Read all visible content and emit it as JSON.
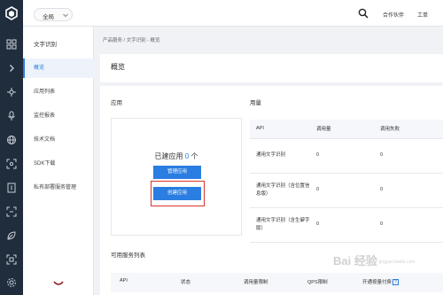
{
  "topbar": {
    "region": "全局",
    "links": [
      "合作伙伴",
      "工单"
    ]
  },
  "rail_icons": [
    "grid-icon",
    "chevron-right-icon",
    "cube-icon",
    "microphone-icon",
    "globe-icon",
    "scan-icon",
    "document-icon",
    "bracket-icon",
    "leaf-icon",
    "frame-icon",
    "gear-icon"
  ],
  "sidebar": {
    "title": "文字识别",
    "items": [
      {
        "label": "概览",
        "active": true
      },
      {
        "label": "应用列表"
      },
      {
        "label": "监控报表"
      },
      {
        "label": "技术文档"
      },
      {
        "label": "SDK下载"
      },
      {
        "label": "私有部署服务管理"
      }
    ]
  },
  "breadcrumb": "产品服务 / 文字识别 - 概览",
  "page_title": "概览",
  "apps": {
    "section_title": "应用",
    "created_prefix": "已建应用",
    "created_count": "0",
    "created_suffix": "个",
    "manage_button": "管理应用",
    "create_button": "创建应用"
  },
  "usage": {
    "section_title": "用量",
    "columns": [
      "API",
      "调用量",
      "调用失败"
    ],
    "rows": [
      {
        "api": "通用文字识别",
        "calls": "0",
        "failed": "0"
      },
      {
        "api": "通用文字识别（含位置信息版）",
        "calls": "0",
        "failed": "0"
      },
      {
        "api": "通用文字识别（含生僻字版）",
        "calls": "0",
        "failed": "0"
      }
    ]
  },
  "services": {
    "section_title": "可用服务列表",
    "columns": [
      "API",
      "状态",
      "调用量限制",
      "QPS限制",
      "开通按量付费"
    ],
    "help": "?"
  },
  "watermark": {
    "text": "Bai 经验",
    "sub": "jingyan.baidu.com"
  },
  "colors": {
    "accent": "#2a7de1",
    "rail": "#1f2d3d",
    "highlight": "#d9342b"
  }
}
